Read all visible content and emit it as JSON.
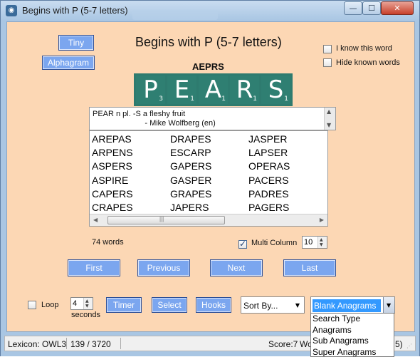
{
  "window": {
    "title": "Begins with P (5-7 letters)",
    "icon": "owl-icon",
    "controls": {
      "minimize": "—",
      "maximize": "☐",
      "close": "✕"
    }
  },
  "toolbar": {
    "tiny_label": "Tiny",
    "alphagram_label": "Alphagram"
  },
  "header": {
    "title": "Begins with P (5-7 letters)"
  },
  "options": {
    "know_word_label": "I know this word",
    "hide_known_label": "Hide known words"
  },
  "puzzle": {
    "alphagram": "AEPRS",
    "tiles": [
      {
        "letter": "P",
        "score": "3"
      },
      {
        "letter": "E",
        "score": "1"
      },
      {
        "letter": "A",
        "score": "1"
      },
      {
        "letter": "R",
        "score": "1"
      },
      {
        "letter": "S",
        "score": "1"
      }
    ]
  },
  "definition": {
    "line1": "PEAR n pl. -S a fleshy fruit",
    "line2": "                        - Mike Wolfberg (en)"
  },
  "words": {
    "columns": [
      [
        "AREPAS",
        "ARPENS",
        "ASPERS",
        "ASPIRE",
        "CAPERS",
        "CRAPES"
      ],
      [
        "DRAPES",
        "ESCARP",
        "GAPERS",
        "GASPER",
        "GRAPES",
        "JAPERS"
      ],
      [
        "JASPER",
        "LAPSER",
        "OPERAS",
        "PACERS",
        "PADRES",
        "PAGERS"
      ]
    ]
  },
  "counts": {
    "word_count": "74 words"
  },
  "multi_column": {
    "label": "Multi Column",
    "checked": true,
    "value": "10"
  },
  "nav": {
    "first": "First",
    "previous": "Previous",
    "next": "Next",
    "last": "Last"
  },
  "controls": {
    "loop_label": "Loop",
    "seconds_value": "4",
    "seconds_label": "seconds",
    "timer_label": "Timer",
    "select_label": "Select",
    "hooks_label": "Hooks",
    "sort_by": "Sort By...",
    "mode": "Blank Anagrams"
  },
  "mode_options": [
    "Search Type",
    "Anagrams",
    "Sub Anagrams",
    "Super Anagrams"
  ],
  "status": {
    "lexicon": "Lexicon: OWL3",
    "position": "139 / 3720",
    "score": "Score:7",
    "wo": "Wo",
    "tail": "5)"
  }
}
